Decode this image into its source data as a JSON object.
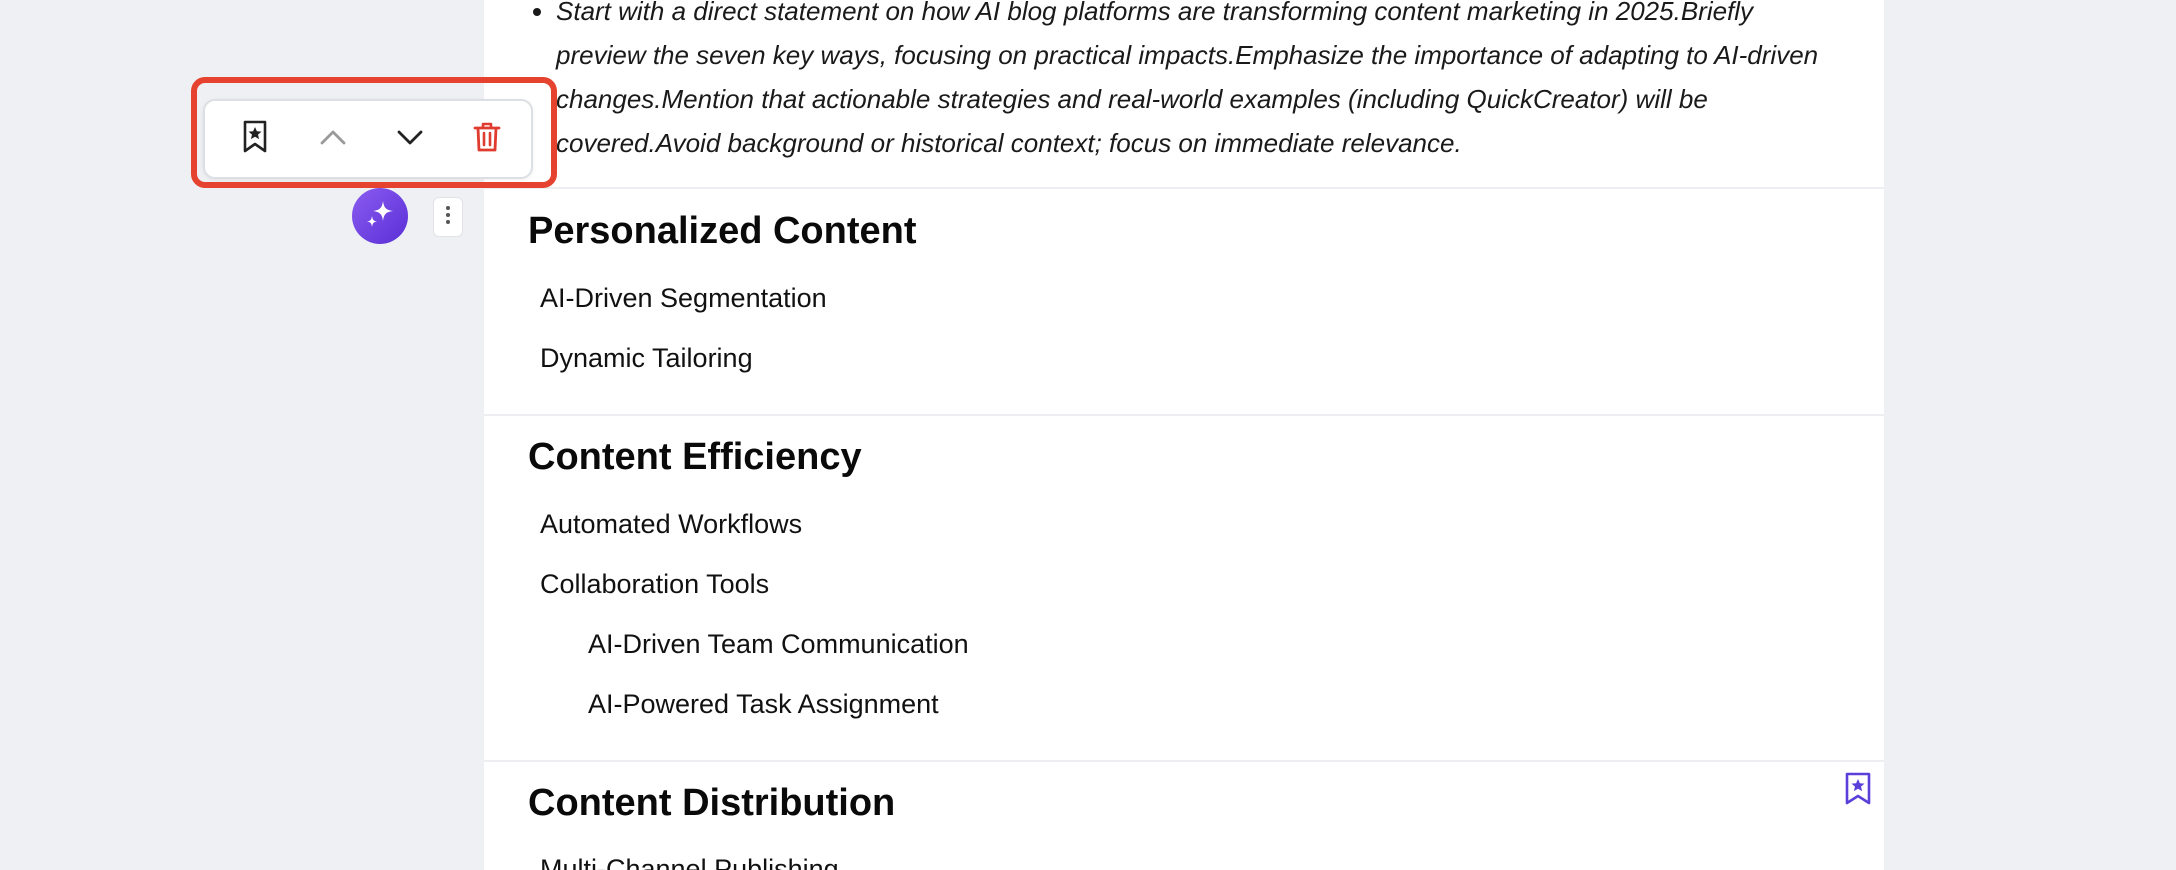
{
  "intro": {
    "text": "Start with a direct statement on how AI blog platforms are transforming content marketing in 2025.Briefly preview the seven key ways, focusing on practical impacts.Emphasize the importance of adapting to AI-driven changes.Mention that actionable strategies and real-world examples (including QuickCreator) will be covered.Avoid background or historical context; focus on immediate relevance."
  },
  "toolbar": {
    "icons": [
      "bookmark-star-icon",
      "chevron-up-icon",
      "chevron-down-icon",
      "trash-icon"
    ],
    "colors": {
      "highlight": "#e5432f",
      "delete": "#e03b2f",
      "disabled": "#9a9a9a",
      "accent": "#5b3fd9"
    }
  },
  "sections": [
    {
      "title": "Personalized Content",
      "items": [
        "AI-Driven Segmentation",
        "Dynamic Tailoring"
      ]
    },
    {
      "title": "Content Efficiency",
      "items": [
        "Automated Workflows",
        "Collaboration Tools"
      ],
      "subitems": [
        "AI-Driven Team Communication",
        "AI-Powered Task Assignment"
      ]
    },
    {
      "title": "Content Distribution",
      "items": [
        "Multi-Channel Publishing"
      ]
    }
  ]
}
